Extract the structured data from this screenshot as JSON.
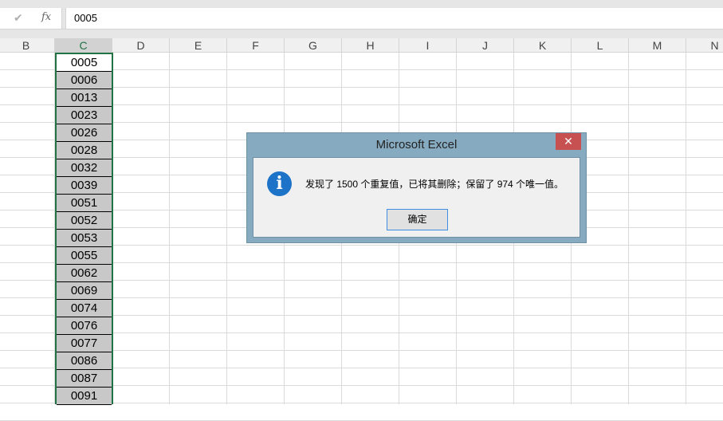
{
  "formula_bar": {
    "cancel_icon": "check-icon",
    "fx_label": "fx",
    "value": "0005"
  },
  "columns": [
    "B",
    "C",
    "D",
    "E",
    "F",
    "G",
    "H",
    "I",
    "J",
    "K",
    "L",
    "M",
    "N"
  ],
  "selected_column": "C",
  "column_c_values": [
    "0005",
    "0006",
    "0013",
    "0023",
    "0026",
    "0028",
    "0032",
    "0039",
    "0051",
    "0052",
    "0053",
    "0055",
    "0062",
    "0069",
    "0074",
    "0076",
    "0077",
    "0086",
    "0087",
    "0091"
  ],
  "dialog": {
    "title": "Microsoft Excel",
    "close_label": "✕",
    "icon": "info-icon",
    "message": "发现了 1500 个重复值，已将其删除；保留了 974 个唯一值。",
    "ok_label": "确定"
  },
  "colors": {
    "selection": "#217346",
    "dialog_frame": "#86abc1",
    "close_button": "#c75050",
    "info_icon": "#1c73c8"
  }
}
